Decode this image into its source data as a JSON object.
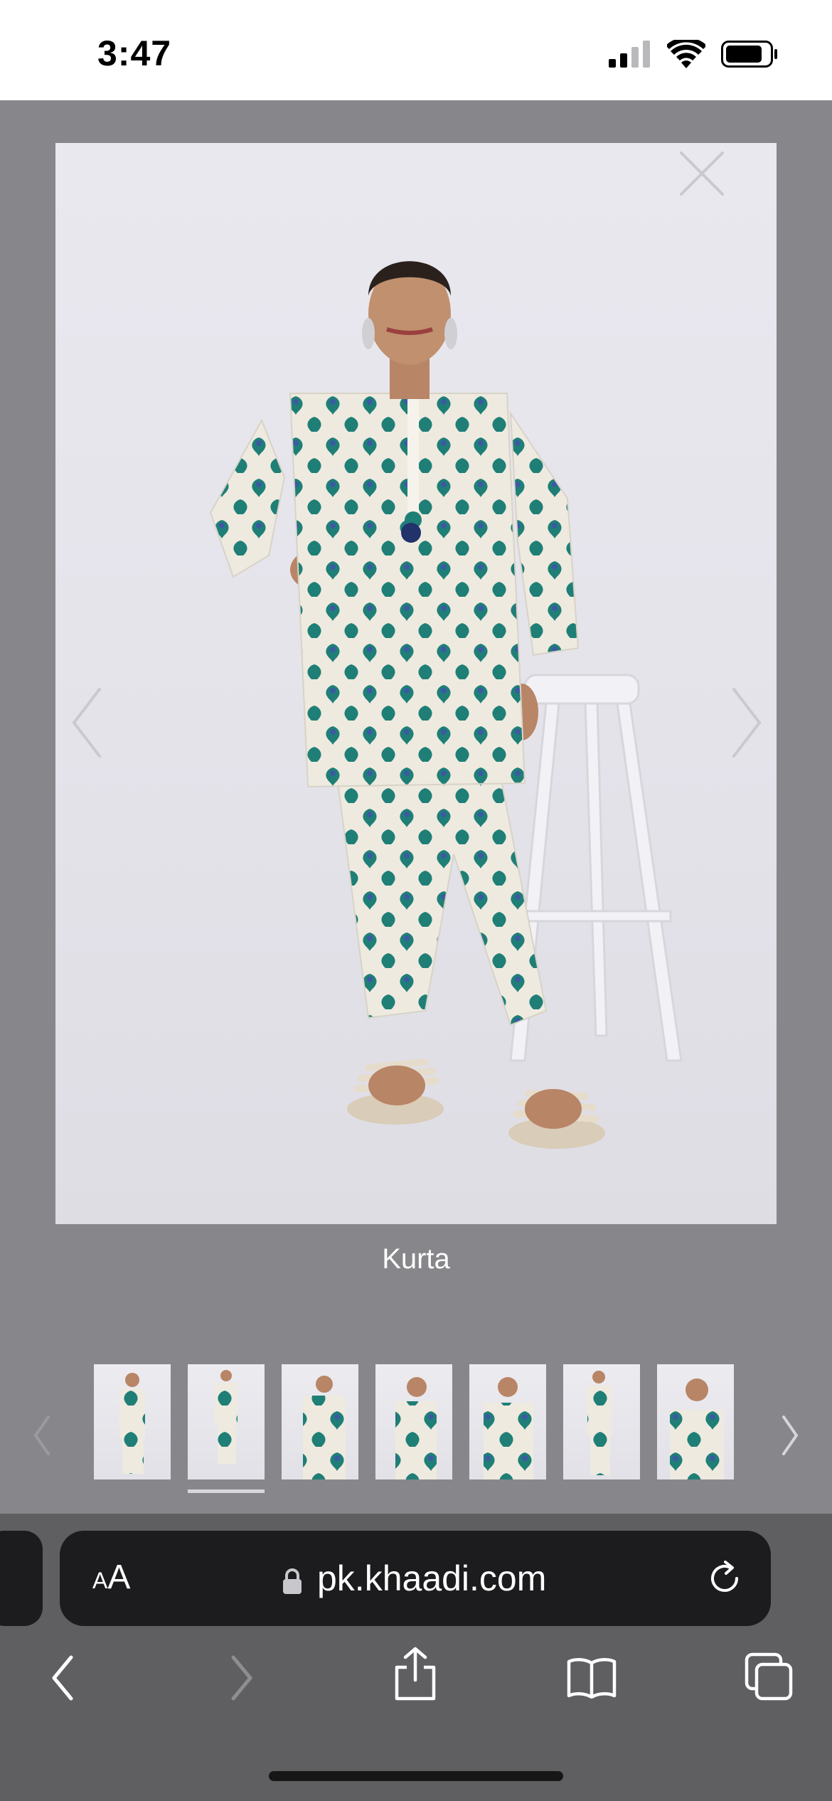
{
  "status_bar": {
    "time": "3:47",
    "icons": [
      "cellular-signal-icon",
      "wifi-icon",
      "battery-icon"
    ]
  },
  "gallery": {
    "caption": "Kurta",
    "selected_index": 1,
    "thumbnail_count": 7,
    "icons": {
      "close": "close-icon",
      "previous": "chevron-left-icon",
      "next": "chevron-right-icon"
    }
  },
  "browser": {
    "text_size_small": "A",
    "text_size_large": "A",
    "url": "pk.khaadi.com",
    "icons": [
      "lock-icon",
      "reload-icon",
      "back-icon",
      "forward-icon",
      "share-icon",
      "bookmarks-icon",
      "tabs-icon"
    ]
  },
  "colors": {
    "overlay": "#87878b",
    "toolbar": "#5f5f62",
    "url_bar": "#1c1c1e",
    "print_teal": "#1f7f76",
    "print_blue": "#3b5aa3"
  }
}
